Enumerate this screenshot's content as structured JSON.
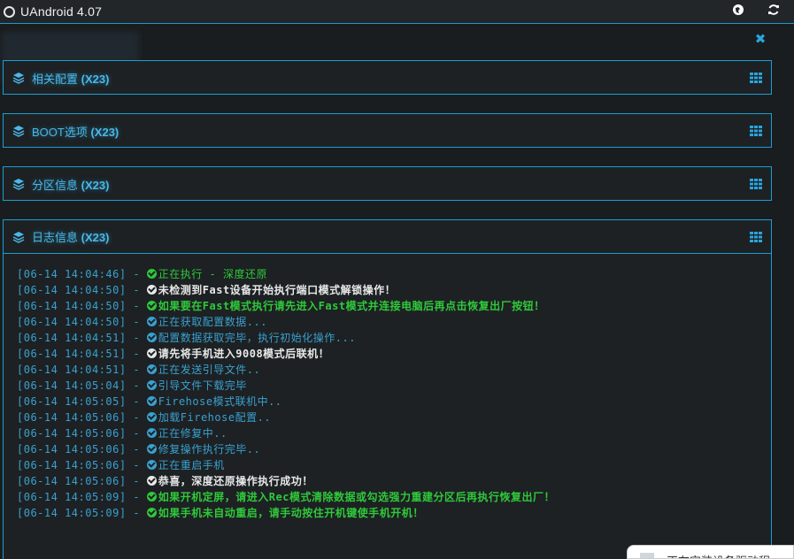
{
  "app": {
    "title": "UAndroid 4.07"
  },
  "colors": {
    "accent": "#1a9fd4",
    "green": "#2fc93a",
    "white": "#e8e8e8",
    "blue": "#3aa0d0"
  },
  "panels": [
    {
      "label": "相关配置",
      "badge": "(X23)"
    },
    {
      "label": "BOOT选项",
      "badge": "(X23)"
    },
    {
      "label": "分区信息",
      "badge": "(X23)"
    },
    {
      "label": "日志信息",
      "badge": "(X23)"
    }
  ],
  "log": [
    {
      "ts": "[06-14 14:04:46]",
      "msg": "正在执行 - 深度还原",
      "style": "green"
    },
    {
      "ts": "[06-14 14:04:50]",
      "msg": "未检测到Fast设备开始执行端口模式解锁操作！",
      "style": "white"
    },
    {
      "ts": "[06-14 14:04:50]",
      "msg": "如果要在Fast模式执行请先进入Fast模式并连接电脑后再点击恢复出厂按钮！",
      "style": "green-b"
    },
    {
      "ts": "[06-14 14:04:50]",
      "msg": "正在获取配置数据...",
      "style": "blue"
    },
    {
      "ts": "[06-14 14:04:51]",
      "msg": "配置数据获取完毕，执行初始化操作...",
      "style": "blue"
    },
    {
      "ts": "[06-14 14:04:51]",
      "msg": "请先将手机进入9008模式后联机！",
      "style": "white"
    },
    {
      "ts": "[06-14 14:04:51]",
      "msg": "正在发送引导文件..",
      "style": "blue"
    },
    {
      "ts": "[06-14 14:05:04]",
      "msg": "引导文件下载完毕",
      "style": "blue"
    },
    {
      "ts": "[06-14 14:05:05]",
      "msg": "Firehose模式联机中..",
      "style": "blue"
    },
    {
      "ts": "[06-14 14:05:06]",
      "msg": "加载Firehose配置..",
      "style": "blue"
    },
    {
      "ts": "[06-14 14:05:06]",
      "msg": "正在修复中..",
      "style": "blue"
    },
    {
      "ts": "[06-14 14:05:06]",
      "msg": "修复操作执行完毕..",
      "style": "blue"
    },
    {
      "ts": "[06-14 14:05:06]",
      "msg": "正在重启手机",
      "style": "blue"
    },
    {
      "ts": "[06-14 14:05:06]",
      "msg": "恭喜，深度还原操作执行成功！",
      "style": "white"
    },
    {
      "ts": "[06-14 14:05:09]",
      "msg": "如果开机定屏，请进入Rec模式清除数据或勾选强力重建分区后再执行恢复出厂！",
      "style": "green-b"
    },
    {
      "ts": "[06-14 14:05:09]",
      "msg": "如果手机未自动重启，请手动按住开机键使手机开机！",
      "style": "green-b"
    }
  ],
  "popup": {
    "text": "正在安装设备驱动程"
  }
}
